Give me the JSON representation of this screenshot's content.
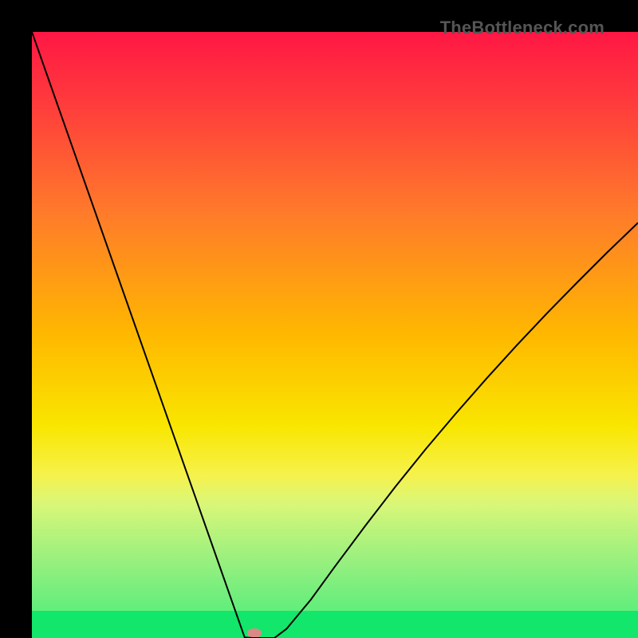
{
  "watermark": "TheBottleneck.com",
  "chart_data": {
    "type": "line",
    "title": "",
    "xlabel": "",
    "ylabel": "",
    "xlim": [
      0,
      100
    ],
    "ylim": [
      0,
      100
    ],
    "grid": false,
    "series": [
      {
        "name": "bottleneck-curve",
        "x": [
          0,
          2.6,
          5.2,
          7.8,
          10.4,
          13.0,
          15.6,
          18.2,
          20.8,
          23.4,
          26.0,
          28.6,
          31.2,
          33.8,
          35.1,
          36.4,
          37.0,
          38.0,
          39.0,
          40.0,
          42.0,
          46.0,
          50.0,
          55.0,
          60.0,
          65.0,
          70.0,
          75.0,
          80.0,
          85.0,
          90.0,
          95.0,
          100.0
        ],
        "y": [
          100.0,
          92.6,
          85.2,
          77.8,
          70.4,
          63.0,
          55.6,
          48.2,
          40.8,
          33.4,
          26.0,
          18.6,
          11.2,
          3.8,
          0.1,
          0.0,
          0.0,
          0.0,
          0.0,
          0.0,
          1.5,
          6.3,
          11.8,
          18.5,
          25.0,
          31.2,
          37.1,
          42.8,
          48.3,
          53.6,
          58.7,
          63.7,
          68.5
        ]
      }
    ],
    "green_band": {
      "y0": 0,
      "y1": 4.5
    },
    "green_band_fade_top": {
      "y0": 4.5,
      "y1": 27
    },
    "marker": {
      "x": 36.7,
      "y": 0.8,
      "color": "#d98a86",
      "rx": 1.2,
      "ry": 0.8
    },
    "gradient_stops": [
      {
        "offset": 0.0,
        "color": "#ff1744"
      },
      {
        "offset": 0.12,
        "color": "#ff3c3c"
      },
      {
        "offset": 0.3,
        "color": "#ff7b2a"
      },
      {
        "offset": 0.5,
        "color": "#ffb800"
      },
      {
        "offset": 0.65,
        "color": "#f9e600"
      },
      {
        "offset": 0.78,
        "color": "#f4f97a"
      },
      {
        "offset": 0.88,
        "color": "#dff58a"
      },
      {
        "offset": 0.955,
        "color": "#c4f78f"
      },
      {
        "offset": 1.0,
        "color": "#12e66b"
      }
    ]
  }
}
